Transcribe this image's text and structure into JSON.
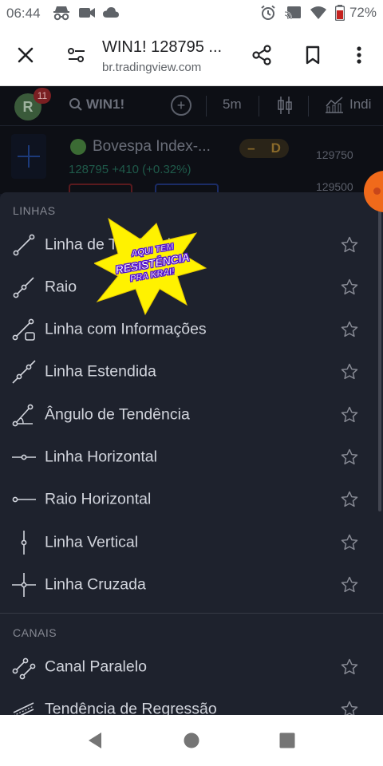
{
  "status_bar": {
    "time": "06:44",
    "battery": "72%"
  },
  "browser": {
    "title": "WIN1! 128795 ...",
    "url": "br.tradingview.com"
  },
  "tv_toolbar": {
    "avatar_letter": "R",
    "notification_count": "11",
    "symbol": "WIN1!",
    "interval": "5m",
    "indicators_label": "Indi"
  },
  "tv_legend": {
    "name": "Bovespa Index-...",
    "pill_minus": "–",
    "pill_letter": "D",
    "price_line": "128795 +410 (+0.32%)",
    "price_scale_top": "129750",
    "price_scale_bottom": "129500"
  },
  "sections": [
    {
      "title": "LINHAS",
      "items": [
        {
          "label": "Linha de Tendência",
          "icon": "trend-line-icon"
        },
        {
          "label": "Raio",
          "icon": "ray-icon"
        },
        {
          "label": "Linha com Informações",
          "icon": "info-line-icon"
        },
        {
          "label": "Linha Estendida",
          "icon": "extended-line-icon"
        },
        {
          "label": "Ângulo de Tendência",
          "icon": "trend-angle-icon"
        },
        {
          "label": "Linha Horizontal",
          "icon": "horizontal-line-icon"
        },
        {
          "label": "Raio Horizontal",
          "icon": "horizontal-ray-icon"
        },
        {
          "label": "Linha Vertical",
          "icon": "vertical-line-icon"
        },
        {
          "label": "Linha Cruzada",
          "icon": "cross-line-icon"
        }
      ]
    },
    {
      "title": "CANAIS",
      "items": [
        {
          "label": "Canal Paralelo",
          "icon": "parallel-channel-icon"
        },
        {
          "label": "Tendência de Regressão",
          "icon": "regression-trend-icon"
        }
      ]
    }
  ],
  "sticker": {
    "line1": "AQUI TEM",
    "line2": "RESISTÊNCIA",
    "line3": "PRA KRAI!"
  },
  "colors": {
    "sheet_bg": "#1e222d",
    "text": "#d1d4dc",
    "section_head": "#868993",
    "star": "#868993",
    "sticker_yellow": "#fff200",
    "sticker_purple": "#5a1de0"
  }
}
